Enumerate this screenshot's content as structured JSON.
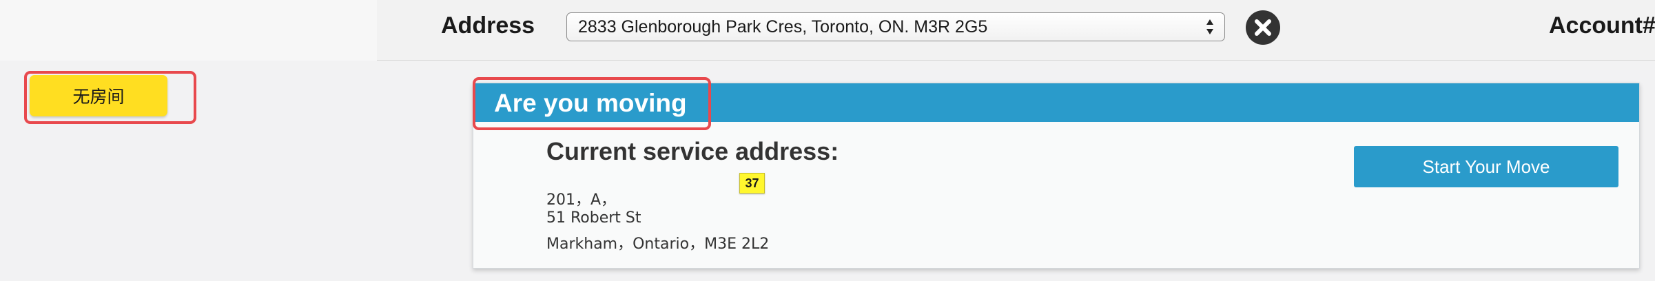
{
  "header": {
    "address_label": "Address",
    "selected_address": "2833 Glenborough Park Cres, Toronto, ON. M3R 2G5",
    "account_label": "Account#",
    "clear_icon": "close-circle-icon"
  },
  "sidebar": {
    "no_room_label": "无房间",
    "button_color": "#ffde21"
  },
  "moving_card": {
    "title": "Are you moving",
    "service_heading": "Current service address:",
    "address_lines": [
      "201，A，",
      "51 Robert St",
      "Markham，Ontario，M3E 2L2"
    ],
    "start_move_label": "Start Your Move",
    "accent_color": "#2a9bcb"
  },
  "badge": {
    "count": "37"
  },
  "highlight_color": "#e8494d"
}
